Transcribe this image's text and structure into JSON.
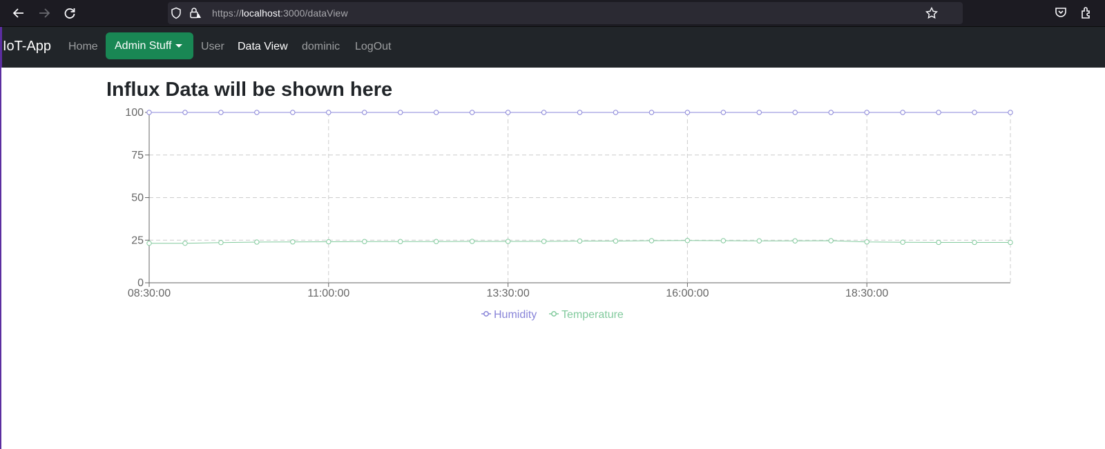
{
  "browser": {
    "url_prefix": "https://",
    "url_host": "localhost",
    "url_rest": ":3000/dataView"
  },
  "navbar": {
    "brand": "IoT-App",
    "links": [
      "Home",
      "User",
      "Data View",
      "dominic",
      "LogOut"
    ],
    "admin_dropdown_label": "Admin Stuff",
    "active_link": "Data View"
  },
  "main": {
    "title": "Influx Data will be shown here"
  },
  "chart_data": {
    "type": "line",
    "title": "",
    "xlabel": "",
    "ylabel": "",
    "ylim": [
      0,
      100
    ],
    "y_ticks": [
      "0",
      "25",
      "50",
      "75",
      "100"
    ],
    "x_tick_labels": [
      "08:30:00",
      "11:00:00",
      "13:30:00",
      "16:00:00",
      "18:30:00"
    ],
    "x": [
      "08:30:00",
      "09:00:00",
      "09:30:00",
      "10:00:00",
      "10:30:00",
      "11:00:00",
      "11:30:00",
      "12:00:00",
      "12:30:00",
      "13:00:00",
      "13:30:00",
      "14:00:00",
      "14:30:00",
      "15:00:00",
      "15:30:00",
      "16:00:00",
      "16:30:00",
      "17:00:00",
      "17:30:00",
      "18:00:00",
      "18:30:00",
      "19:00:00",
      "19:30:00",
      "20:00:00",
      "20:30:00"
    ],
    "grid": true,
    "legend_position": "bottom",
    "series": [
      {
        "name": "Humidity",
        "color": "#8884d8",
        "values": [
          100,
          100,
          100,
          100,
          100,
          100,
          100,
          100,
          100,
          100,
          100,
          100,
          100,
          100,
          100,
          100,
          100,
          100,
          100,
          100,
          100,
          100,
          100,
          100,
          100
        ]
      },
      {
        "name": "Temperature",
        "color": "#82ca9d",
        "values": [
          23.2,
          23.2,
          23.6,
          23.9,
          24.0,
          24.1,
          24.2,
          24.2,
          24.2,
          24.3,
          24.3,
          24.3,
          24.5,
          24.5,
          24.7,
          24.8,
          24.7,
          24.6,
          24.6,
          24.7,
          24.0,
          23.8,
          23.7,
          23.7,
          23.7
        ]
      }
    ]
  }
}
